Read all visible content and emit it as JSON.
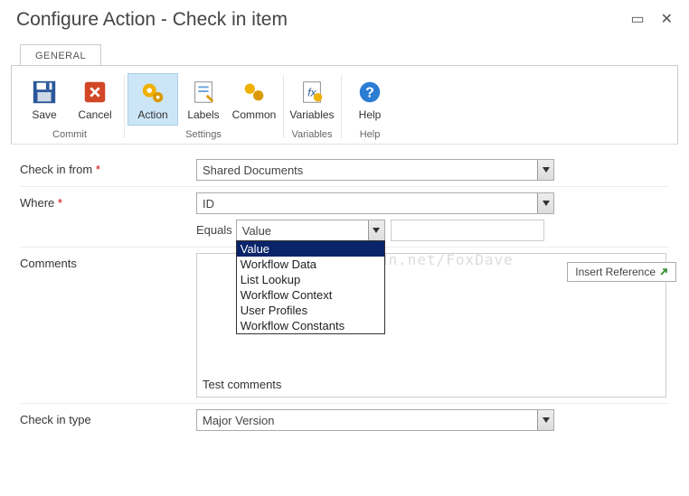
{
  "title": "Configure Action - Check in item",
  "tabs": {
    "general": "GENERAL"
  },
  "ribbon": {
    "commit": {
      "title": "Commit",
      "save": "Save",
      "cancel": "Cancel"
    },
    "settings": {
      "title": "Settings",
      "action": "Action",
      "labels": "Labels",
      "common": "Common"
    },
    "variables": {
      "title": "Variables",
      "variables": "Variables"
    },
    "help": {
      "title": "Help",
      "help": "Help"
    }
  },
  "form": {
    "checkin_from": {
      "label": "Check in from",
      "value": "Shared Documents"
    },
    "where": {
      "label": "Where",
      "value": "ID",
      "equals_label": "Equals",
      "equals_value": "Value",
      "equals_text": "",
      "options": [
        "Value",
        "Workflow Data",
        "List Lookup",
        "Workflow Context",
        "User Profiles",
        "Workflow Constants"
      ],
      "selected_option": "Value"
    },
    "comments": {
      "label": "Comments",
      "value": "Test comments"
    },
    "checkin_type": {
      "label": "Check in type",
      "value": "Major Version"
    },
    "insert_reference": "Insert Reference"
  },
  "watermark": "http://blog.csdn.net/FoxDave"
}
